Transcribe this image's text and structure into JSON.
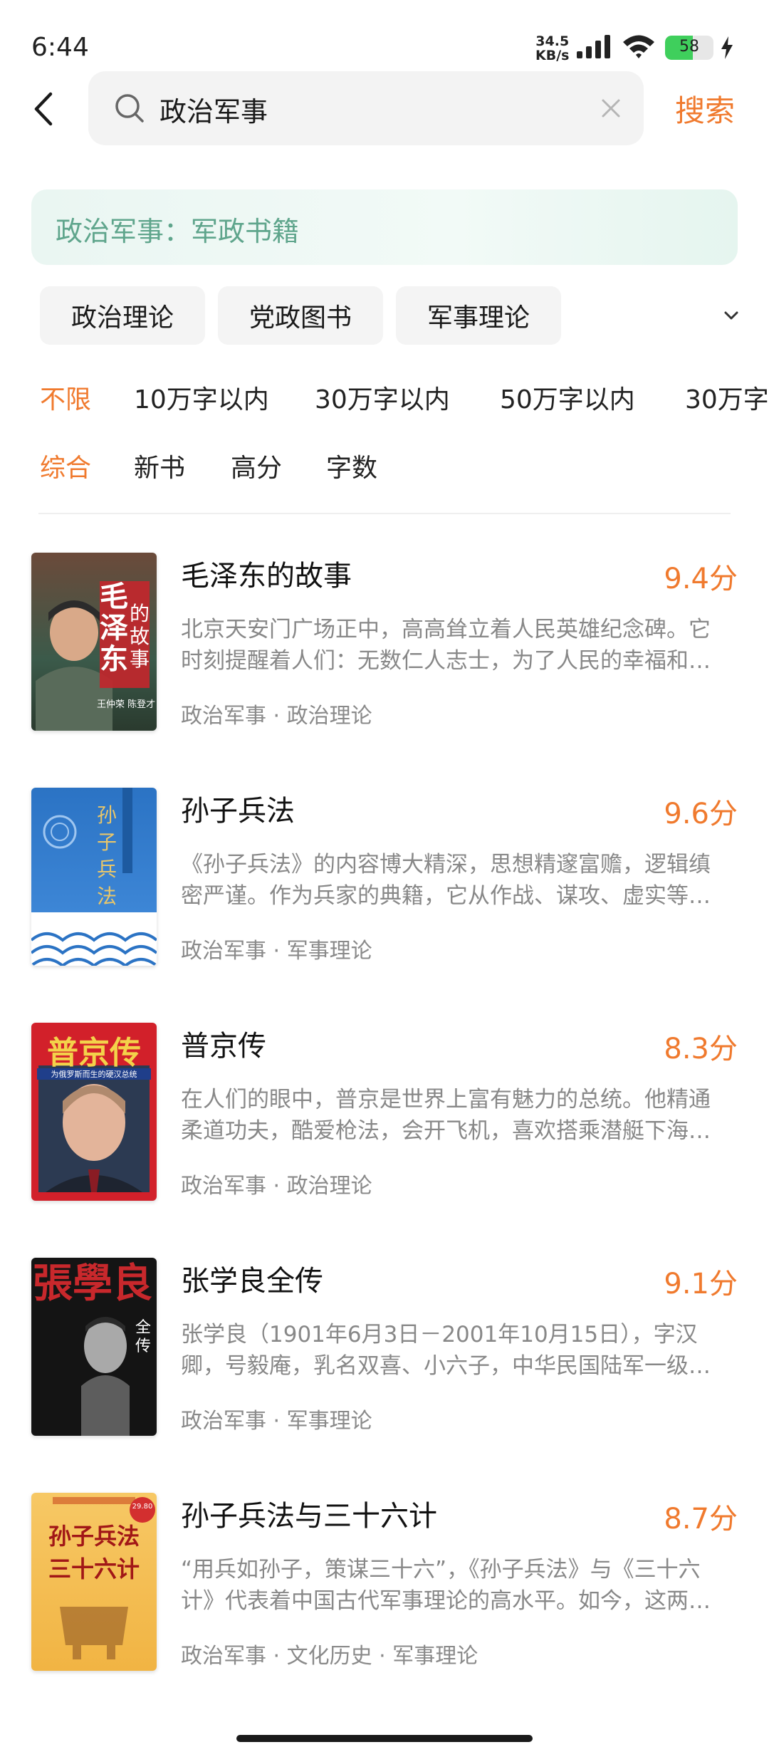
{
  "status": {
    "time": "6:44",
    "net_speed_value": "34.5",
    "net_speed_unit": "KB/s",
    "battery": "58",
    "battery_level": 0.58
  },
  "search": {
    "query": "政治军事",
    "button_label": "搜索"
  },
  "banner": {
    "text": "政治军事：军政书籍"
  },
  "subcategories": [
    "政治理论",
    "党政图书",
    "军事理论"
  ],
  "word_filters": [
    "不限",
    "10万字以内",
    "30万字以内",
    "50万字以内",
    "30万字"
  ],
  "sort_filters": [
    "综合",
    "新书",
    "高分",
    "字数"
  ],
  "books": [
    {
      "title": "毛泽东的故事",
      "score": "9.4分",
      "desc": "北京天安门广场正中，高高耸立着人民英雄纪念碑。它时刻提醒着人们：无数仁人志士，为了人民的幸福和民族的解放而献出了生命…",
      "tags": "政治军事 · 政治理论",
      "cover_text_a": "毛泽东",
      "cover_text_b": "的故事",
      "cover_author": "王仲荣 陈登才 著"
    },
    {
      "title": "孙子兵法",
      "score": "9.6分",
      "desc": "《孙子兵法》的内容博大精深，思想精邃富赡，逻辑缜密严谨。作为兵家的典籍，它从作战、谋攻、虚实等方面阐述了战争的规律…",
      "tags": "政治军事 · 军事理论",
      "cover_text_a": "孙子兵法"
    },
    {
      "title": "普京传",
      "score": "8.3分",
      "desc": "在人们的眼中，普京是世界上富有魅力的总统。他精通柔道功夫，酷爱枪法，会开飞机，喜欢搭乘潜艇下海探险…",
      "tags": "政治军事 · 政治理论",
      "cover_text_a": "普京传",
      "cover_text_b": "为俄罗斯而生的硬汉总统"
    },
    {
      "title": "张学良全传",
      "score": "9.1分",
      "desc": "张学良（1901年6月3日－2001年10月15日），字汉卿，号毅庵，乳名双喜、小六子，中华民国陆军一级上将…",
      "tags": "政治军事 · 军事理论",
      "cover_text_a": "張學良",
      "cover_text_b": "全传"
    },
    {
      "title": "孙子兵法与三十六计",
      "score": "8.7分",
      "desc": "“用兵如孙子，策谋三十六”，《孙子兵法》与《三十六计》代表着中国古代军事理论的高水平。如今，这两部书已经走向世界…",
      "tags": "政治军事 · 文化历史 · 军事理论",
      "cover_text_a": "孙子兵法",
      "cover_text_b": "三十六计",
      "cover_badge": "29.80"
    }
  ]
}
